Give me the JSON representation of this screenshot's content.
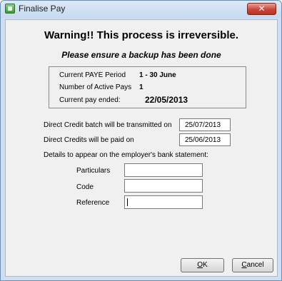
{
  "window": {
    "title": "Finalise Pay",
    "close_label": "✕"
  },
  "warning": {
    "heading": "Warning!!  This process is irreversible.",
    "subheading": "Please ensure a backup has been done"
  },
  "info": {
    "period_label": "Current PAYE Period",
    "period_value": "1 - 30 June",
    "active_pays_label": "Number of Active Pays",
    "active_pays_value": "1",
    "pay_ended_label": "Current pay ended:",
    "pay_ended_value": "22/05/2013"
  },
  "form": {
    "transmit_label": "Direct Credit batch will be transmitted on",
    "transmit_value": "25/07/2013",
    "paid_label": "Direct Credits will be paid on",
    "paid_value": "25/06/2013",
    "statement_label": "Details to appear on the employer's bank statement:",
    "particulars_label": "Particulars",
    "particulars_value": "",
    "code_label": "Code",
    "code_value": "",
    "reference_label": "Reference",
    "reference_value": ""
  },
  "buttons": {
    "ok_mnemonic": "O",
    "ok_rest": "K",
    "cancel_mnemonic": "C",
    "cancel_rest": "ancel"
  }
}
